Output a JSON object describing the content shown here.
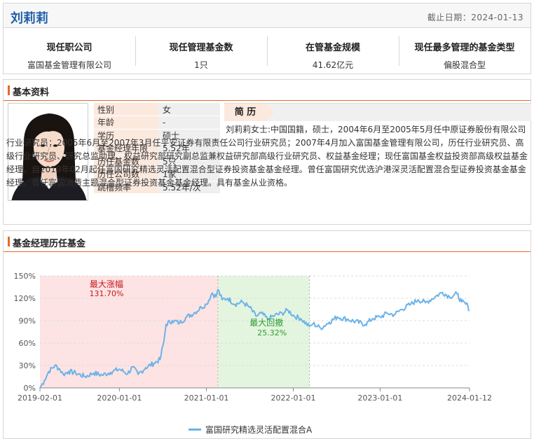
{
  "manager": {
    "name": "刘莉莉",
    "as_of": "截止日期：2024-01-13"
  },
  "summary": [
    {
      "title": "现任职公司",
      "value": "富国基金管理有限公司"
    },
    {
      "title": "现任管理基金数",
      "value": "1只"
    },
    {
      "title": "在管基金规模",
      "value": "41.62亿元"
    },
    {
      "title": "现任最多管理的基金类型",
      "value": "偏股混合型"
    }
  ],
  "basic": {
    "section_title": "基本资料",
    "fields": [
      {
        "label": "性别",
        "value": "女"
      },
      {
        "label": "年龄",
        "value": "-"
      },
      {
        "label": "学历",
        "value": "硕士"
      },
      {
        "label": "基金经理年限",
        "value": "5.52年"
      },
      {
        "label": "历任基金数",
        "value": "5只"
      },
      {
        "label": "历任公司数",
        "value": "1家"
      },
      {
        "label": "跳槽频率",
        "value": "5.52年/次"
      }
    ],
    "bio_title": "简  历",
    "bio_text": "刘莉莉女士:中国国籍，硕士，2004年6月至2005年5月任中原证券股份有限公司行业研究员；2005年6月至2007年3月任平安证券有限责任公司行业研究员；2007年4月加入富国基金管理有限公司，历任行业研究员、高级行业研究员、研究总监助理、权益研究部研究副总监兼权益研究部高级行业研究员、权益基金经理；现任富国基金权益投资部高级权益基金经理。自2019年02月起任富国研究精选灵活配置混合型证券投资基金基金经理。曾任富国研究优选沪港深灵活配置混合型证券投资基金基金经理。曾任富国消费主题混合型证券投资基金基金经理。具有基金从业资格。"
  },
  "history": {
    "section_title": "基金经理历任基金"
  },
  "chart_data": {
    "type": "line",
    "y_ticks": [
      "0%",
      "30%",
      "60%",
      "90%",
      "120%",
      "150%"
    ],
    "ylim": [
      0,
      150
    ],
    "x_ticks": [
      "2019-02-01",
      "2020-01-01",
      "2021-01-01",
      "2022-01-01",
      "2023-01-01",
      "2024-01-12"
    ],
    "xlim": [
      "2019-02-01",
      "2024-01-12"
    ],
    "grid": "horizontal dashed",
    "legend_position": "bottom-center",
    "colors": {
      "line": "#6db3e8",
      "rise_zone": "#fde3e3",
      "drawdown_zone": "#e3f5df",
      "rise_text": "#c8161d",
      "drawdown_text": "#2e9c2e"
    },
    "max_rise": {
      "label": "最大涨幅",
      "value": "131.70%",
      "start": "2019-02-01",
      "end": "2021-02-18"
    },
    "max_drawdown": {
      "label": "最大回撤",
      "value": "25.32%",
      "start": "2021-02-18",
      "end": "2022-03-10"
    },
    "series": [
      {
        "name": "富国研究精选灵活配置混合A",
        "points": [
          [
            "2019-02-01",
            0
          ],
          [
            "2019-02-20",
            10
          ],
          [
            "2019-03-10",
            22
          ],
          [
            "2019-04-05",
            30
          ],
          [
            "2019-04-25",
            25
          ],
          [
            "2019-05-10",
            18
          ],
          [
            "2019-06-01",
            22
          ],
          [
            "2019-07-01",
            20
          ],
          [
            "2019-08-10",
            15
          ],
          [
            "2019-09-15",
            20
          ],
          [
            "2019-10-20",
            17
          ],
          [
            "2019-11-25",
            21
          ],
          [
            "2020-01-01",
            25
          ],
          [
            "2020-02-05",
            19
          ],
          [
            "2020-02-25",
            28
          ],
          [
            "2020-03-20",
            18
          ],
          [
            "2020-04-20",
            27
          ],
          [
            "2020-05-25",
            33
          ],
          [
            "2020-06-20",
            38
          ],
          [
            "2020-07-06",
            62
          ],
          [
            "2020-07-15",
            85
          ],
          [
            "2020-08-10",
            90
          ],
          [
            "2020-09-10",
            87
          ],
          [
            "2020-10-10",
            95
          ],
          [
            "2020-11-10",
            100
          ],
          [
            "2020-12-10",
            108
          ],
          [
            "2021-01-01",
            112
          ],
          [
            "2021-01-25",
            127
          ],
          [
            "2021-02-10",
            122
          ],
          [
            "2021-02-18",
            131.7
          ],
          [
            "2021-03-08",
            118
          ],
          [
            "2021-04-01",
            120
          ],
          [
            "2021-05-01",
            112
          ],
          [
            "2021-06-01",
            115
          ],
          [
            "2021-07-01",
            108
          ],
          [
            "2021-07-28",
            96
          ],
          [
            "2021-08-20",
            100
          ],
          [
            "2021-09-15",
            92
          ],
          [
            "2021-10-15",
            97
          ],
          [
            "2021-11-15",
            100
          ],
          [
            "2021-12-10",
            104
          ],
          [
            "2022-01-05",
            96
          ],
          [
            "2022-02-01",
            93
          ],
          [
            "2022-03-10",
            82
          ],
          [
            "2022-03-25",
            86
          ],
          [
            "2022-04-26",
            80
          ],
          [
            "2022-06-01",
            88
          ],
          [
            "2022-07-05",
            95
          ],
          [
            "2022-08-15",
            92
          ],
          [
            "2022-10-31",
            85
          ],
          [
            "2022-12-01",
            93
          ],
          [
            "2023-01-01",
            95
          ],
          [
            "2023-02-01",
            100
          ],
          [
            "2023-03-01",
            98
          ],
          [
            "2023-04-01",
            105
          ],
          [
            "2023-05-10",
            112
          ],
          [
            "2023-06-10",
            118
          ],
          [
            "2023-07-10",
            114
          ],
          [
            "2023-08-20",
            122
          ],
          [
            "2023-09-20",
            128
          ],
          [
            "2023-10-20",
            122
          ],
          [
            "2023-11-20",
            126
          ],
          [
            "2023-12-10",
            115
          ],
          [
            "2024-01-05",
            110
          ],
          [
            "2024-01-12",
            104
          ]
        ]
      }
    ]
  }
}
